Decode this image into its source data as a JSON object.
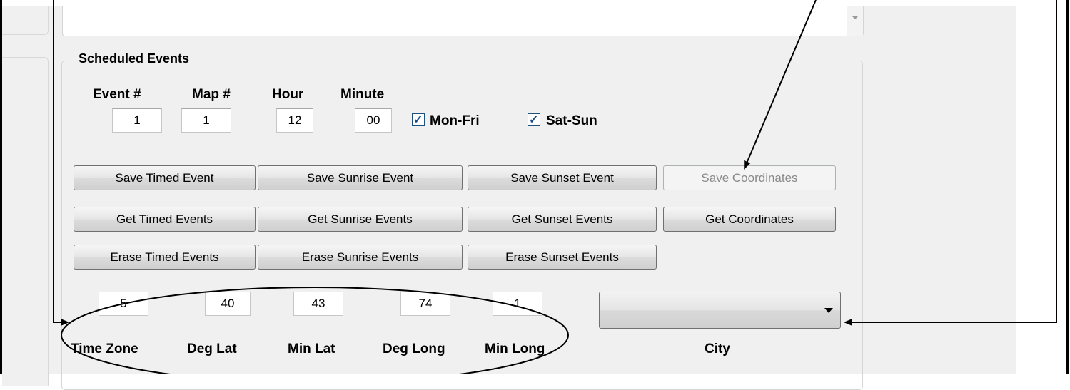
{
  "group": {
    "title": "Scheduled Events"
  },
  "columns": [
    {
      "label": "Event #",
      "value": "1"
    },
    {
      "label": "Map #",
      "value": "1"
    },
    {
      "label": "Hour",
      "value": "12"
    },
    {
      "label": "Minute",
      "value": "00"
    }
  ],
  "checkboxes": [
    {
      "label": "Mon-Fri",
      "checked": true
    },
    {
      "label": "Sat-Sun",
      "checked": true
    }
  ],
  "buttons": {
    "row1": [
      "Save Timed Event",
      "Save Sunrise Event",
      "Save Sunset Event",
      "Save Coordinates"
    ],
    "row2": [
      "Get Timed Events",
      "Get Sunrise Events",
      "Get Sunset Events",
      "Get Coordinates"
    ],
    "row3": [
      "Erase Timed Events",
      "Erase Sunrise Events",
      "Erase Sunset Events"
    ],
    "disabled": [
      "Save Coordinates"
    ]
  },
  "coordinates": [
    {
      "label": "Time Zone",
      "value": "5"
    },
    {
      "label": "Deg Lat",
      "value": "40"
    },
    {
      "label": "Min Lat",
      "value": "43"
    },
    {
      "label": "Deg Long",
      "value": "74"
    },
    {
      "label": "Min Long",
      "value": "1"
    }
  ],
  "city": {
    "label": "City",
    "value": ""
  },
  "icons": {
    "scroll_down": "chevron-down-icon",
    "combo_arrow": "dropdown-arrow-icon",
    "check": "checkmark-icon"
  },
  "colors": {
    "window_bg": "#f0f0f0",
    "checkbox_border": "#1c5180",
    "disabled_text": "#8a8a8a"
  }
}
